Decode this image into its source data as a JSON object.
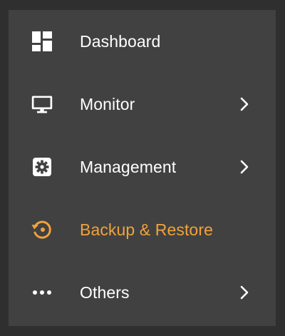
{
  "colors": {
    "background": "#2f2f2f",
    "panel": "#414141",
    "text": "#ffffff",
    "active": "#f0a33b"
  },
  "menu": {
    "items": [
      {
        "label": "Dashboard",
        "icon": "dashboard-icon",
        "has_submenu": false,
        "active": false
      },
      {
        "label": "Monitor",
        "icon": "monitor-icon",
        "has_submenu": true,
        "active": false
      },
      {
        "label": "Management",
        "icon": "settings-gear-icon",
        "has_submenu": true,
        "active": false
      },
      {
        "label": "Backup & Restore",
        "icon": "backup-restore-icon",
        "has_submenu": false,
        "active": true
      },
      {
        "label": "Others",
        "icon": "more-dots-icon",
        "has_submenu": true,
        "active": false
      }
    ]
  }
}
